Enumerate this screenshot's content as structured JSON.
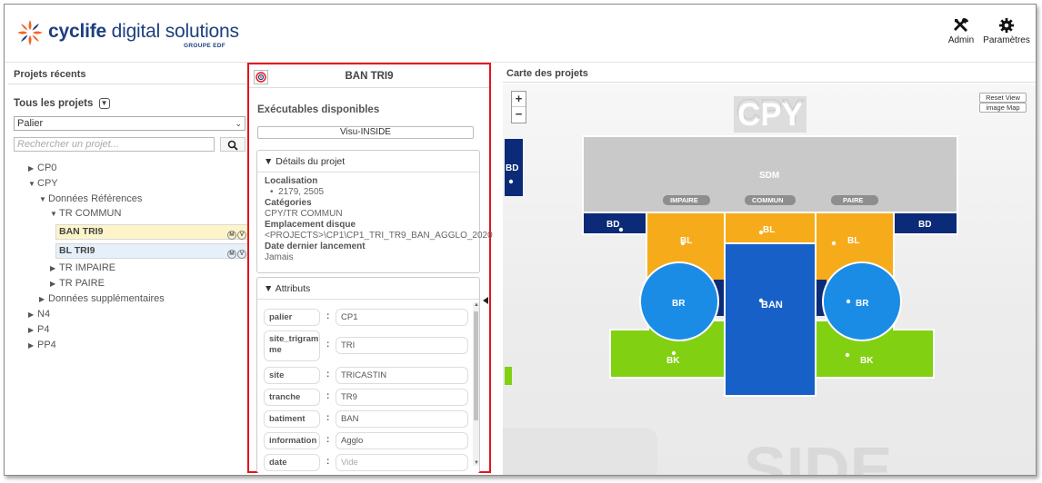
{
  "header": {
    "brand_strong": "cyclife",
    "brand_rest": " digital solutions",
    "brand_sub": "GROUPE EDF",
    "admin_label": "Admin",
    "settings_label": "Paramètres"
  },
  "left": {
    "title": "Projets récents",
    "all_projects": "Tous les projets",
    "filter_value": "Palier",
    "search_placeholder": "Rechercher un projet...",
    "tree": [
      {
        "label": "CP0",
        "state": "collapsed",
        "level": 0
      },
      {
        "label": "CPY",
        "state": "expanded",
        "level": 0
      },
      {
        "label": "Données Références",
        "state": "expanded",
        "level": 1
      },
      {
        "label": "TR COMMUN",
        "state": "expanded",
        "level": 2
      },
      {
        "label": "TR IMPAIRE",
        "state": "collapsed",
        "level": 2
      },
      {
        "label": "TR PAIRE",
        "state": "collapsed",
        "level": 2
      },
      {
        "label": "Données supplémentaires",
        "state": "collapsed",
        "level": 1
      },
      {
        "label": "N4",
        "state": "collapsed",
        "level": 0
      },
      {
        "label": "P4",
        "state": "collapsed",
        "level": 0
      },
      {
        "label": "PP4",
        "state": "collapsed",
        "level": 0
      }
    ],
    "projects": [
      {
        "label": "BAN TRI9",
        "selected": true,
        "badge_m": "M",
        "badge_v": "V"
      },
      {
        "label": "BL TRI9",
        "selected": false,
        "badge_m": "M",
        "badge_v": "V"
      }
    ]
  },
  "detail": {
    "title": "BAN TRI9",
    "exec_title": "Exécutables disponibles",
    "exec_button": "Visu-INSIDE",
    "details_header": "▼ Détails du projet",
    "loc_label": "Localisation",
    "loc_value": "2179, 2505",
    "cat_label": "Catégories",
    "cat_value": "CPY/TR COMMUN",
    "disk_label": "Emplacement disque",
    "disk_value": "<PROJECTS>\\CP1\\CP1_TRI_TR9_BAN_AGGLO_2020",
    "last_label": "Date dernier lancement",
    "last_value": "Jamais",
    "attrs_header": "▼ Attributs",
    "attributes": [
      {
        "key": "palier",
        "value": "CP1",
        "placeholder": false
      },
      {
        "key": "site_trigramme",
        "value": "TRI",
        "placeholder": false
      },
      {
        "key": "site",
        "value": "TRICASTIN",
        "placeholder": false
      },
      {
        "key": "tranche",
        "value": "TR9",
        "placeholder": false
      },
      {
        "key": "batiment",
        "value": "BAN",
        "placeholder": false
      },
      {
        "key": "information",
        "value": "Agglo",
        "placeholder": false
      },
      {
        "key": "date",
        "value": "Vide",
        "placeholder": true
      }
    ],
    "site_trigram_line1": "site_trigram",
    "site_trigram_line2": "me"
  },
  "map": {
    "title": "Carte des projets",
    "zoom_in": "+",
    "zoom_out": "−",
    "reset_view": "Reset View",
    "image_map": "image Map",
    "labels": {
      "cpy": "CPY",
      "sdm": "SDM",
      "impaire": "IMPAIRE",
      "commun": "COMMUN",
      "paire": "PAIRE",
      "bd": "BD",
      "bl": "BL",
      "br": "BR",
      "ban": "BAN",
      "bk": "BK",
      "inside": "SIDE"
    }
  },
  "colors": {
    "navy": "#0b2a78",
    "orange": "#f6ac1a",
    "blue": "#1660c8",
    "circle": "#1b8ce6",
    "green": "#82d012",
    "gray": "#c9c9c9",
    "brand_orange": "#f26522",
    "brand_blue": "#1d3f7e",
    "highlight": "#e4141b"
  }
}
